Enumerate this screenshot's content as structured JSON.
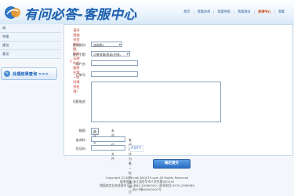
{
  "header": {
    "title": "有问必答-客服中心",
    "nav": [
      {
        "label": "首页",
        "current": false
      },
      {
        "label": "我要咨询",
        "current": false
      },
      {
        "label": "我要举报",
        "current": false
      },
      {
        "label": "我要建议",
        "current": false
      },
      {
        "label": "咨询中心",
        "current": true
      },
      {
        "label": "我要",
        "current": false
      }
    ]
  },
  "sidebar": {
    "items": [
      "询",
      "举报",
      "建议",
      "意见"
    ],
    "result_button": "处理结果查询 >>>"
  },
  "form": {
    "notice": "请详细描述您的问题,您所反映的问题将在第一时间得到处理!",
    "fields": {
      "category_label": "咨询类别:",
      "category_value": "咨询类1",
      "subject_label": "所在主题:",
      "subject_value": "订单咨询/投诉(不限)",
      "username_label": "用户名:",
      "order_label": "订单号:",
      "desc_label": "问题描述:",
      "screenshot_label": "截图:",
      "file_button": "选择文件",
      "file_status": "未选择任何文件",
      "password_label": "查询码:",
      "password_hint": "查询码作为唯一标识,请牢记",
      "captcha_label": "验证码:",
      "captcha_text": "PQFF"
    },
    "submit_label": "确定提交"
  },
  "footer": {
    "lines": [
      "Copyright ©2009 mall.800579.com All Rights Reserved",
      "联系地址:浙江温金华市人民东路000018",
      "增值电信业务经营许可证:浙B2-20080000 / 联系电话:0579-2998369",
      "浙ICP备09000001号"
    ]
  }
}
